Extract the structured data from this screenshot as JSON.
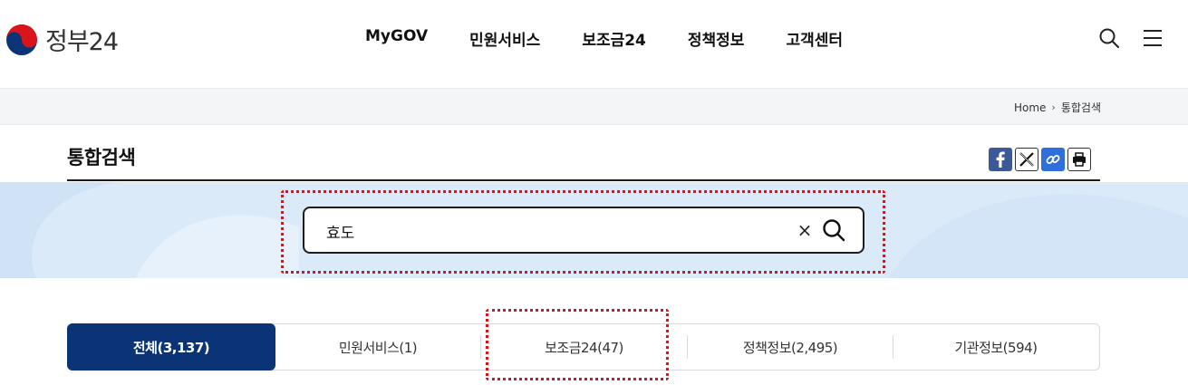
{
  "header": {
    "logo_text": "정부24",
    "nav": [
      "MyGOV",
      "민원서비스",
      "보조금24",
      "정책정보",
      "고객센터"
    ],
    "icons": [
      "search-icon",
      "menu-icon"
    ]
  },
  "breadcrumb": {
    "home": "Home",
    "current": "통합검색"
  },
  "page": {
    "title": "통합검색",
    "share_icons": [
      "facebook-icon",
      "x-icon",
      "link-icon",
      "print-icon"
    ]
  },
  "search": {
    "value": "효도",
    "clear_label": "×"
  },
  "tabs": [
    {
      "label": "전체(3,137)",
      "active": true
    },
    {
      "label": "민원서비스(1)",
      "active": false
    },
    {
      "label": "보조금24(47)",
      "active": false
    },
    {
      "label": "정책정보(2,495)",
      "active": false
    },
    {
      "label": "기관정보(594)",
      "active": false
    }
  ],
  "colors": {
    "brand_navy": "#0b3476",
    "search_band": "#dbeaf9",
    "highlight_red": "#d9141b",
    "facebook": "#3b5998",
    "link_blue": "#2f6fdc"
  }
}
